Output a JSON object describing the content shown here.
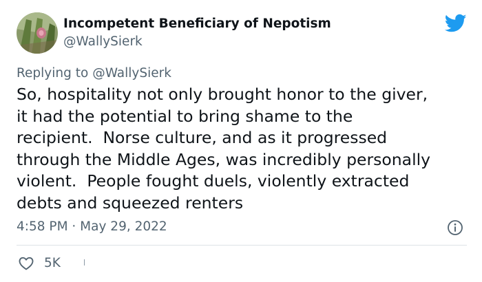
{
  "author": {
    "name": "Incompetent Beneficiary of Nepotism",
    "handle": "@WallySierk",
    "avatar_icon": "avatar-photo"
  },
  "brand": {
    "icon": "twitter-bird-icon",
    "color": "#1d9bf0"
  },
  "reply": {
    "prefix": "Replying to",
    "handle": "@WallySierk"
  },
  "tweet": {
    "text": "So, hospitality not only brought honor to the giver,\nit had the potential to bring shame to the\nrecipient.  Norse culture, and as it progressed\nthrough the Middle Ages, was incredibly personally\nviolent.  People fought duels, violently extracted\ndebts and squeezed renters",
    "timestamp": "4:58 PM · May 29, 2022",
    "info_icon": "info-icon"
  },
  "actions": {
    "like_icon": "heart-icon",
    "like_count": "5K"
  },
  "colors": {
    "text_primary": "#0f1419",
    "text_secondary": "#536471",
    "divider": "#dde2e6"
  }
}
